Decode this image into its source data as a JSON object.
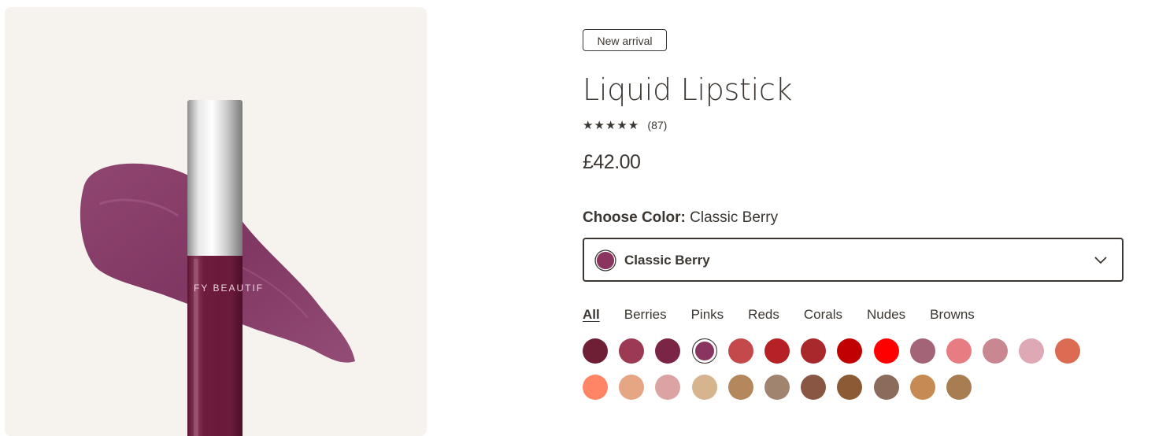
{
  "product": {
    "badge": "New arrival",
    "title": "Liquid Lipstick",
    "stars": "★★★★★",
    "review_count": "(87)",
    "rating": 5,
    "price": "£42.00",
    "image_brand_text": "FY BEAUTIF"
  },
  "color_picker": {
    "choose_label": "Choose Color:",
    "selected_name": "Classic Berry",
    "dropdown_value": "Classic Berry",
    "selected_color": "#893560"
  },
  "filters": {
    "tabs": [
      "All",
      "Berries",
      "Pinks",
      "Reds",
      "Corals",
      "Nudes",
      "Browns"
    ],
    "active": "All"
  },
  "swatches": [
    "#6e1f35",
    "#9b3a52",
    "#7a2446",
    "#893560",
    "#c4494a",
    "#b52125",
    "#a8282b",
    "#c00000",
    "#ff0000",
    "#a26476",
    "#e87c83",
    "#c98891",
    "#dea8b4",
    "#dc6b53",
    "#ff8566",
    "#e6a583",
    "#dba3a4",
    "#d5b48e",
    "#b5875c",
    "#a08470",
    "#8a5644",
    "#8c5b36",
    "#8b6b5a",
    "#c68b55",
    "#a87d52"
  ],
  "selected_swatch_index": 3,
  "colors": {
    "text": "#3b3631",
    "panel_bg": "#f6f3ef",
    "tube": "#6f1b3e",
    "smear": "#7d2f5d"
  }
}
